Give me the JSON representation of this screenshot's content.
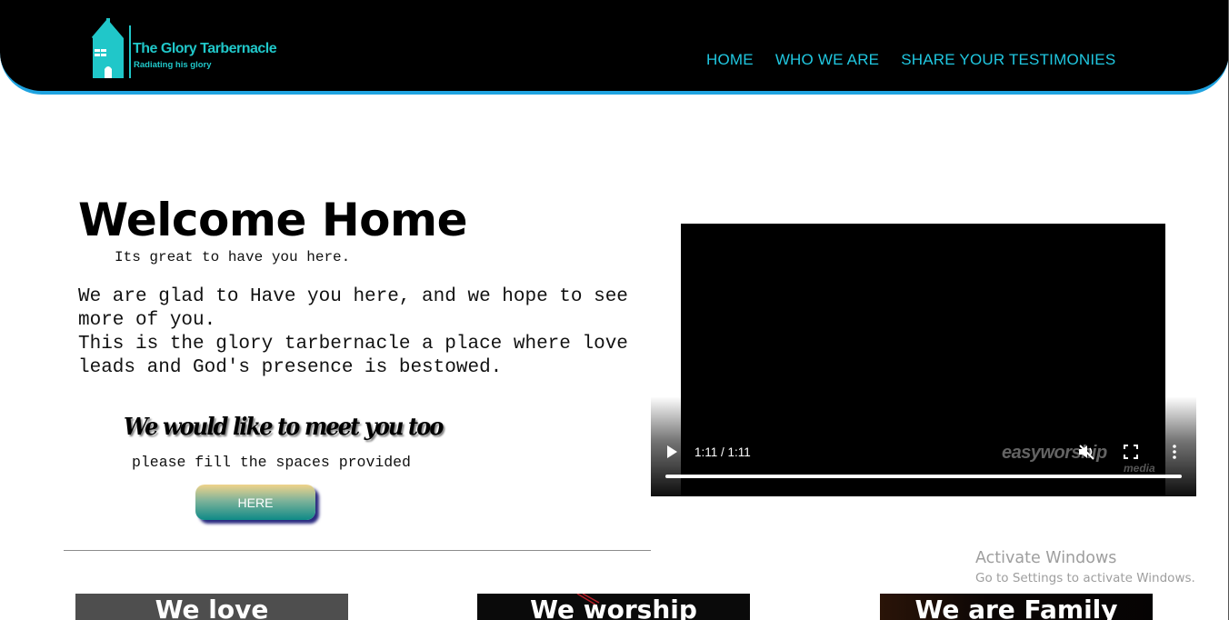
{
  "header": {
    "logo": {
      "title": "The Glory Tarbernacle",
      "tagline": "Radiating his glory",
      "icon": "house-icon"
    },
    "nav": [
      {
        "label": "HOME"
      },
      {
        "label": "WHO WE ARE"
      },
      {
        "label": "SHARE YOUR TESTIMONIES"
      }
    ],
    "colors": {
      "accent": "#20c7e0",
      "border": "#1fa3e0",
      "background": "#000000"
    }
  },
  "hero": {
    "title": "Welcome Home",
    "subtitle": "Its great to have you here.",
    "paragraph_1": "We are glad to Have you here, and we hope to see more of you.",
    "paragraph_2": "This is the glory tarbernacle a place where love leads and God's presence is bestowed.",
    "meet_title": "We would like to meet you too",
    "meet_sub": "please fill the spaces provided",
    "button_label": "HERE"
  },
  "video": {
    "time": "1:11 / 1:11",
    "watermark": "easyworship",
    "watermark_sub": "media",
    "progress": 1.0,
    "controls": {
      "play": "play-icon",
      "mute": "muted-speaker-icon",
      "fullscreen": "fullscreen-icon",
      "more": "more-vertical-icon"
    }
  },
  "system_overlay": {
    "title": "Activate Windows",
    "subtitle": "Go to Settings to activate Windows."
  },
  "cards": [
    {
      "label": "We love"
    },
    {
      "label": "We worship"
    },
    {
      "label": "We are Family"
    }
  ]
}
